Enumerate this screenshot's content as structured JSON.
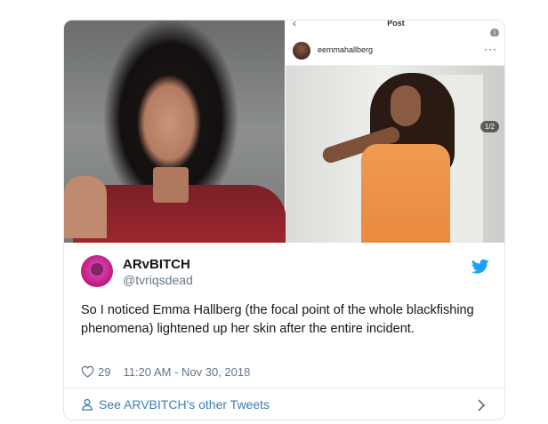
{
  "instagram": {
    "title": "Post",
    "back_glyph": "‹",
    "info_glyph": "i",
    "username": "eemmahallberg",
    "more_glyph": "···",
    "photo_counter": "1/2"
  },
  "tweet": {
    "display_name": "ARvBITCH",
    "handle": "@tvriqsdead",
    "text": "So I noticed Emma Hallberg (the focal point of the whole blackfishing phenomena) lightened up her skin after the entire incident.",
    "likes": "29",
    "timestamp": "11:20 AM - Nov 30, 2018"
  },
  "footer": {
    "link_label": "See ARVBITCH's other Tweets"
  },
  "colors": {
    "twitter_blue": "#1da1f2",
    "link_blue": "#3b7eb8",
    "muted_text": "#657786"
  },
  "icons": [
    "twitter-bird-icon",
    "heart-icon",
    "person-icon",
    "chevron-right-icon",
    "info-icon",
    "back-arrow-icon",
    "more-icon"
  ]
}
